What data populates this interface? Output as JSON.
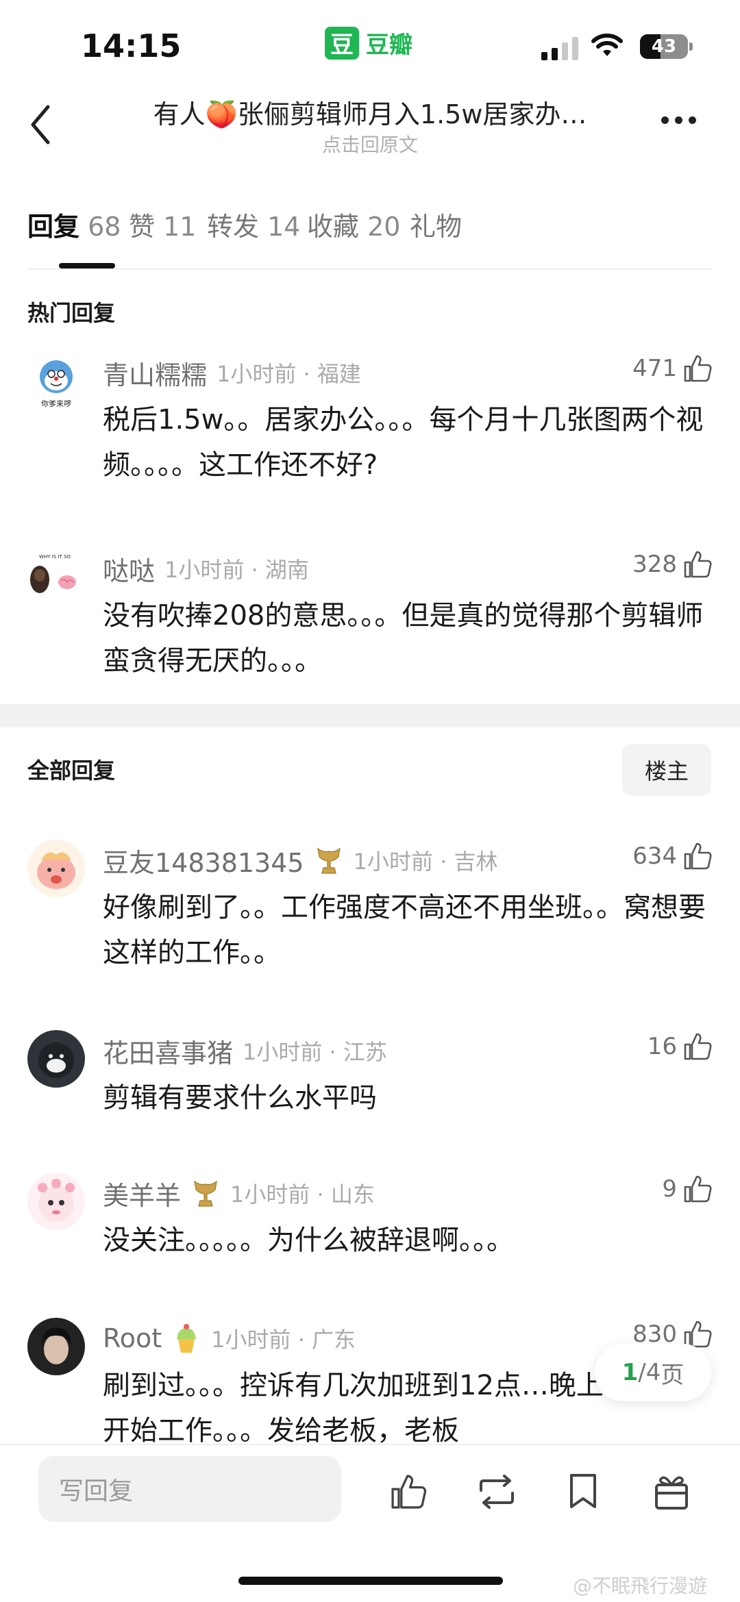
{
  "status_bar": {
    "time": "14:15",
    "app_name": "豆瓣",
    "app_badge": "豆",
    "battery": "43",
    "battery_level": 0.43
  },
  "nav": {
    "title": "有人🍑张俪剪辑师月入1.5w居家办…",
    "subtitle": "点击回原文"
  },
  "tabs": [
    {
      "label": "回复",
      "count": "68",
      "active": true
    },
    {
      "label": "赞",
      "count": "11"
    },
    {
      "label": "转发",
      "count": "14"
    },
    {
      "label": "收藏",
      "count": "20"
    },
    {
      "label": "礼物",
      "count": ""
    }
  ],
  "hot": {
    "title": "热门回复",
    "comments": [
      {
        "name": "青山糯糯",
        "meta": "1小时前 · 福建",
        "likes": "471",
        "text": "税后1.5w。。居家办公。。。每个月十几张图两个视频。。。。这工作还不好?",
        "avatar_caption": "你爹来啰"
      },
      {
        "name": "哒哒",
        "meta": "1小时前 · 湖南",
        "likes": "328",
        "text": "没有吹捧208的意思。。。但是真的觉得那个剪辑师蛮贪得无厌的。。。",
        "avatar_caption": "WHY IS IT SO"
      }
    ]
  },
  "all": {
    "title": "全部回复",
    "op_button": "楼主",
    "comments": [
      {
        "name": "豆友148381345",
        "meta": "1小时前 · 吉林",
        "likes": "634",
        "text": "好像刷到了。。工作强度不高还不用坐班。。窝想要这样的工作。。"
      },
      {
        "name": "花田喜事猪",
        "meta": "1小时前 · 江苏",
        "likes": "16",
        "text": "剪辑有要求什么水平吗"
      },
      {
        "name": "美羊羊",
        "meta": "1小时前 · 山东",
        "likes": "9",
        "text": "没关注。。。。。为什么被辞退啊。。。"
      },
      {
        "name": "Root",
        "meta": "1小时前 · 广东",
        "likes": "830",
        "text": "刷到过。。。控诉有几次加班到12点…晚上十点才开始工作。。。发给老板，老板"
      }
    ]
  },
  "pager": {
    "current": "1",
    "total": "/4",
    "unit": "页"
  },
  "bottom_bar": {
    "placeholder": "写回复"
  },
  "watermark": "@不眠飛行漫遊",
  "colors": {
    "brand_green": "#1fb653",
    "text_primary": "#1a1a1a",
    "text_secondary": "#707070",
    "text_meta": "#aaaaaa"
  }
}
